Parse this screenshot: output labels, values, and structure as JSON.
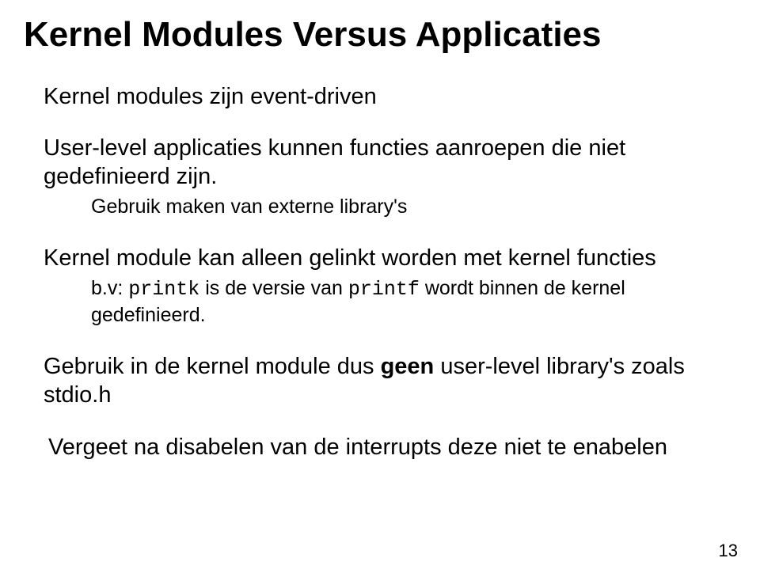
{
  "title": "Kernel Modules Versus Applicaties",
  "line1": "Kernel modules zijn  event-driven",
  "line2": "User-level applicaties kunnen functies aanroepen die niet gedefinieerd zijn.",
  "sub1": "Gebruik maken van externe library's",
  "line3": "Kernel module kan alleen gelinkt worden met  kernel functies",
  "sub2": {
    "prefix": "b.v: ",
    "code1": "printk",
    "mid": " is de versie van ",
    "code2": "printf",
    "suffix": " wordt binnen de kernel gedefinieerd."
  },
  "line4": {
    "prefix": "Gebruik in de kernel module dus ",
    "bold": "geen",
    "suffix": " user-level library's zoals stdio.h"
  },
  "line5": "Vergeet na disabelen van de interrupts deze niet te enabelen",
  "page_number": "13"
}
